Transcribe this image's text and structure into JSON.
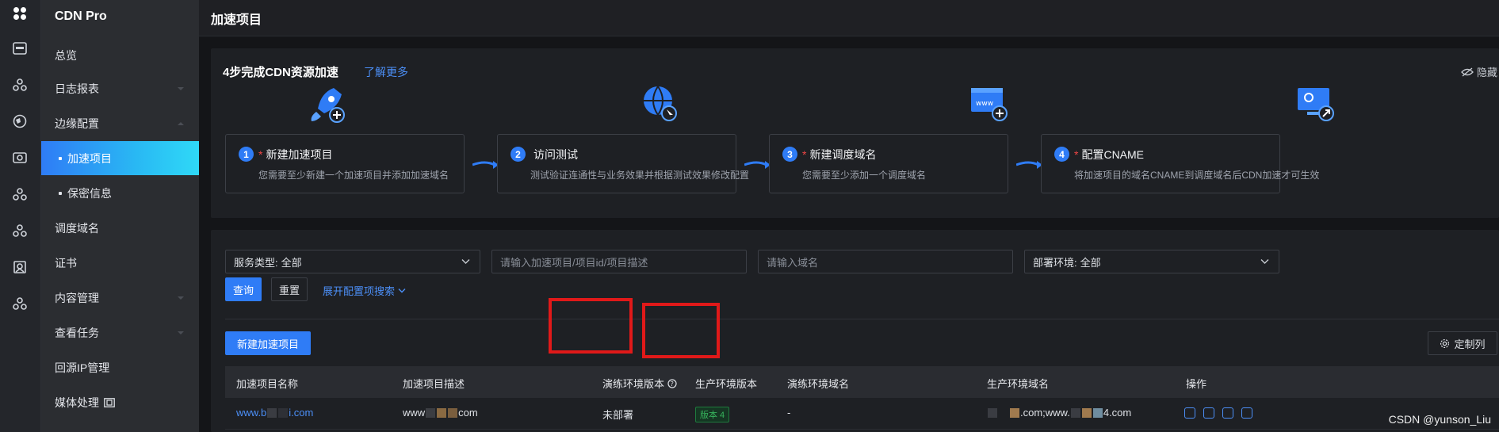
{
  "app": {
    "name": "CDN Pro"
  },
  "sidebar": {
    "items": [
      {
        "label": "总览"
      },
      {
        "label": "日志报表"
      },
      {
        "label": "边缘配置"
      },
      {
        "label": "加速项目"
      },
      {
        "label": "保密信息"
      },
      {
        "label": "调度域名"
      },
      {
        "label": "证书"
      },
      {
        "label": "内容管理"
      },
      {
        "label": "查看任务"
      },
      {
        "label": "回源IP管理"
      },
      {
        "label": "媒体处理"
      }
    ]
  },
  "page": {
    "title": "加速项目"
  },
  "guide": {
    "title": "4步完成CDN资源加速",
    "learn_more": "了解更多",
    "hide": "隐藏",
    "steps": [
      {
        "num": "1",
        "required": "*",
        "title": "新建加速项目",
        "desc": "您需要至少新建一个加速项目并添加加速域名"
      },
      {
        "num": "2",
        "required": "",
        "title": "访问测试",
        "desc": "测试验证连通性与业务效果并根据测试效果修改配置"
      },
      {
        "num": "3",
        "required": "*",
        "title": "新建调度域名",
        "desc": "您需要至少添加一个调度域名"
      },
      {
        "num": "4",
        "required": "*",
        "title": "配置CNAME",
        "desc": "将加速项目的域名CNAME到调度域名后CDN加速才可生效"
      }
    ]
  },
  "filters": {
    "service_type_label": "服务类型:",
    "service_type_value": "全部",
    "project_placeholder": "请输入加速项目/项目id/项目描述",
    "domain_placeholder": "请输入域名",
    "env_label": "部署环境:",
    "env_value": "全部",
    "query": "查询",
    "reset": "重置",
    "expand": "展开配置项搜索"
  },
  "actions": {
    "new_project": "新建加速项目",
    "customize_columns": "定制列"
  },
  "table": {
    "columns": [
      "加速项目名称",
      "加速项目描述",
      "演练环境版本",
      "生产环境版本",
      "演练环境域名",
      "生产环境域名",
      "操作"
    ],
    "rows": [
      {
        "name_prefix": "www.b",
        "name_suffix": "i.com",
        "desc_prefix": "www",
        "desc_suffix": "com",
        "staging_version": "未部署",
        "prod_version": "版本 4",
        "staging_domain": "-",
        "prod_domain": ".com;www.",
        "prod_domain_suffix": "4.com"
      }
    ]
  },
  "watermark": "CSDN @yunson_Liu",
  "colors": {
    "accent": "#2f7cf6",
    "highlight": "#e01919",
    "success": "#37b35c"
  }
}
